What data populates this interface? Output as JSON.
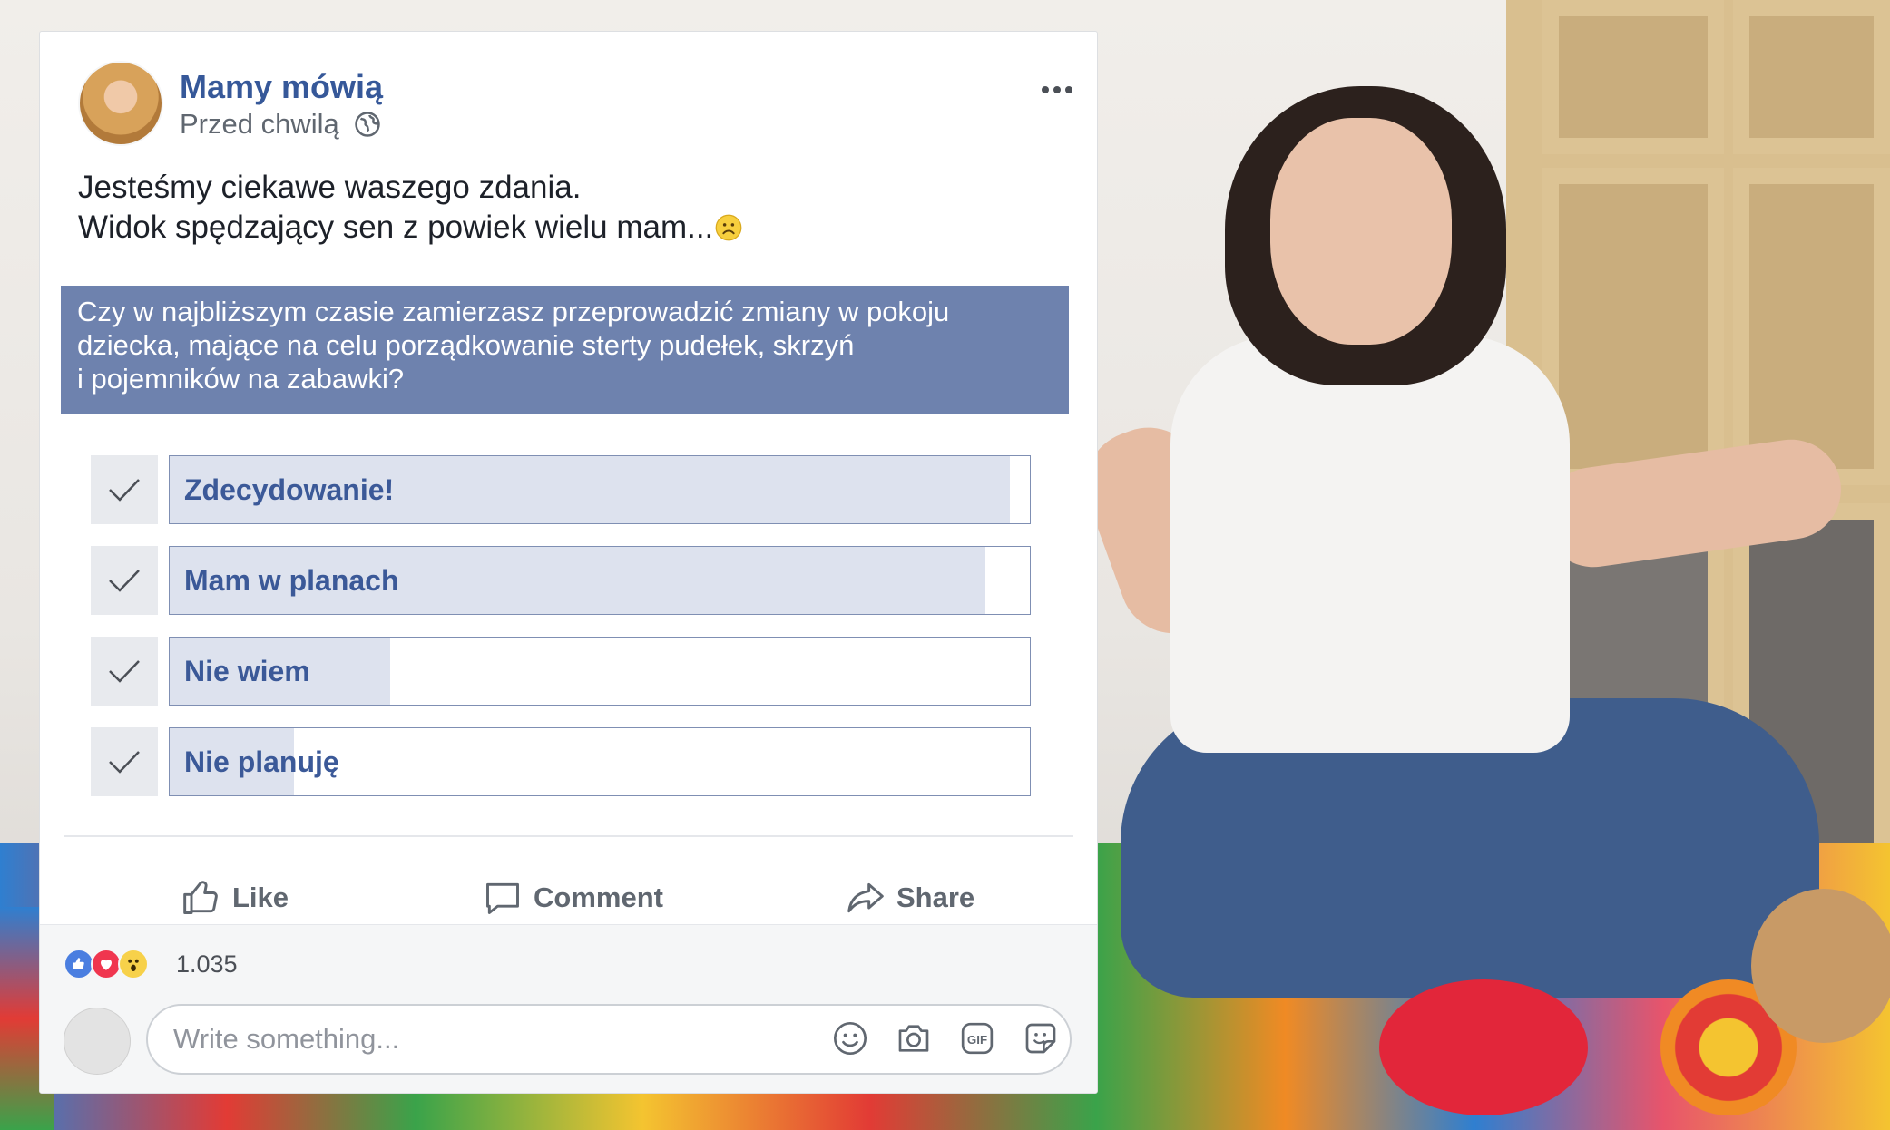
{
  "post": {
    "page_name": "Mamy mówią",
    "time": "Przed chwilą",
    "text_line1": "Jesteśmy ciekawe waszego zdania.",
    "text_line2": "Widok spędzający sen z powiek wielu mam...",
    "emoji": "sad-face-emoji"
  },
  "poll": {
    "question_line1": "Czy w najbliższym czasie zamierzasz przeprowadzić zmiany w pokoju",
    "question_line2": "dziecka, mające na celu porządkowanie sterty pudełek, skrzyń",
    "question_line3": "i pojemników na zabawki?",
    "options": [
      {
        "label": "Zdecydowanie!",
        "fill": 0.977
      },
      {
        "label": "Mam w planach",
        "fill": 0.948
      },
      {
        "label": "Nie wiem",
        "fill": 0.256
      },
      {
        "label": "Nie planuję",
        "fill": 0.145
      }
    ]
  },
  "actions": {
    "like": "Like",
    "comment": "Comment",
    "share": "Share"
  },
  "reactions": {
    "icons": [
      "like-icon",
      "love-icon",
      "wow-icon"
    ],
    "count": "1.035"
  },
  "comment_box": {
    "placeholder": "Write something...",
    "tools": [
      "emoji-icon",
      "camera-icon",
      "gif-icon",
      "sticker-icon"
    ]
  },
  "colors": {
    "link": "#365899",
    "poll_header": "#6e82ae",
    "poll_fill": "#dde2ee"
  }
}
